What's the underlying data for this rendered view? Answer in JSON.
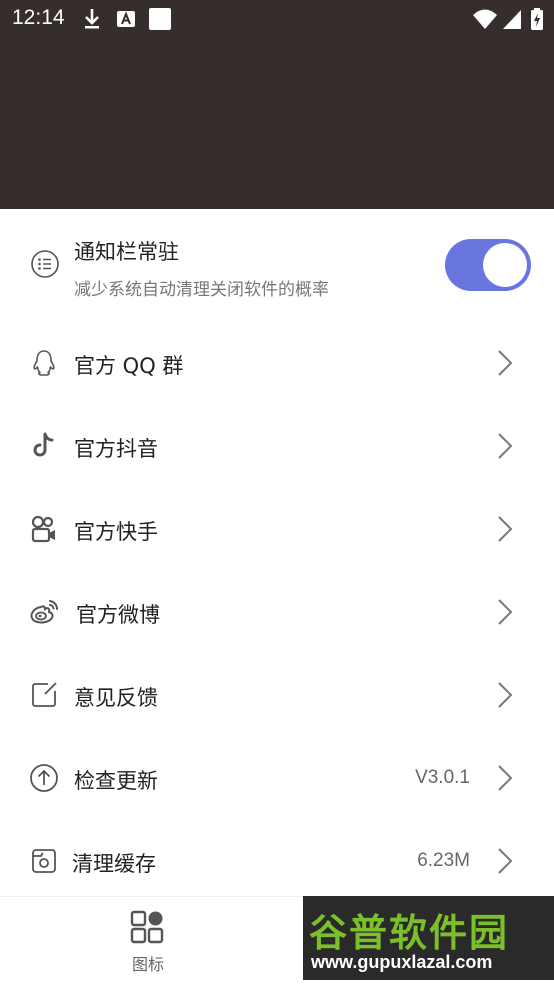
{
  "status_bar": {
    "time": "12:14",
    "icons": [
      "download-icon",
      "a-letter-icon",
      "white-square-icon",
      "wifi-icon",
      "signal-icon",
      "battery-icon"
    ]
  },
  "notification": {
    "title": "通知栏常驻",
    "description": "减少系统自动清理关闭软件的概率",
    "toggle_on": true
  },
  "menu": [
    {
      "icon": "qq-icon",
      "label": "官方 QQ 群",
      "value": ""
    },
    {
      "icon": "tiktok-icon",
      "label": "官方抖音",
      "value": ""
    },
    {
      "icon": "kuaishou-icon",
      "label": "官方快手",
      "value": ""
    },
    {
      "icon": "weibo-icon",
      "label": "官方微博",
      "value": ""
    },
    {
      "icon": "feedback-icon",
      "label": "意见反馈",
      "value": ""
    },
    {
      "icon": "update-icon",
      "label": "检查更新",
      "value": "V3.0.1"
    },
    {
      "icon": "cache-icon",
      "label": "清理缓存",
      "value": "6.23M"
    }
  ],
  "bottom_nav": {
    "tab_label": "图标"
  },
  "watermark": {
    "top": "谷普软件园",
    "bottom": "www.gupuxlazal.com"
  },
  "colors": {
    "header": "#352e2d",
    "accent": "#6a76e0"
  }
}
